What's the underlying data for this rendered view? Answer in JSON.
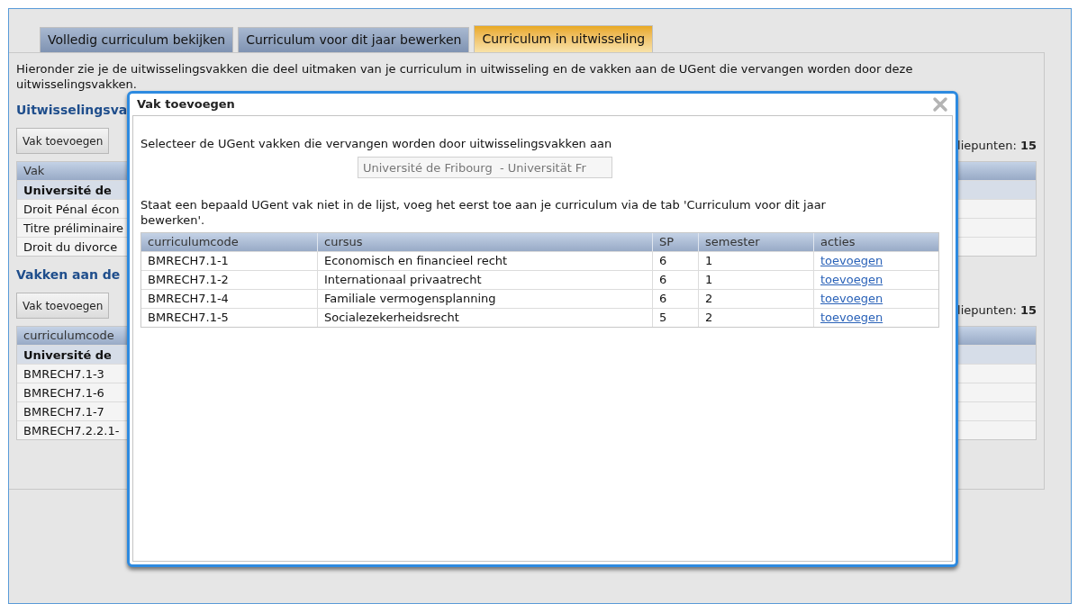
{
  "tabs": [
    {
      "label": "Volledig curriculum bekijken",
      "selected": false
    },
    {
      "label": "Curriculum voor dit jaar bewerken",
      "selected": false
    },
    {
      "label": "Curriculum in uitwisseling",
      "selected": true
    }
  ],
  "intro": [
    "Hieronder zie je de uitwisselingsvakken die deel uitmaken van je curriculum in uitwisseling en de vakken aan de UGent die vervangen worden door deze",
    "uitwisselingsvakken."
  ],
  "sections": [
    {
      "heading": "Uitwisselingsva",
      "button": "Vak toevoegen",
      "credits": "liepunten: **15**",
      "column": "Vak",
      "rows": [
        {
          "text": "Université de ",
          "kind": "group"
        },
        {
          "text": "Droit Pénal écon",
          "kind": "course"
        },
        {
          "text": "Titre préliminaire",
          "kind": "course"
        },
        {
          "text": "Droit du divorce",
          "kind": "course"
        }
      ]
    },
    {
      "heading": "Vakken aan de",
      "button": "Vak toevoegen",
      "credits": "liepunten: **15**",
      "column": "curriculumcode",
      "rows": [
        {
          "text": "Université de ",
          "kind": "group"
        },
        {
          "text": "BMRECH7.1-3",
          "kind": "course"
        },
        {
          "text": "BMRECH7.1-6",
          "kind": "course"
        },
        {
          "text": "BMRECH7.1-7",
          "kind": "course"
        },
        {
          "text": "BMRECH7.2.2.1-",
          "kind": "course"
        }
      ]
    }
  ],
  "dialog": {
    "title": "Vak toevoegen",
    "prompt": "Selecteer de UGent vakken die vervangen worden door uitwisselingsvakken aan",
    "university_field": {
      "value": "Université de Fribourg  - Universität Fr"
    },
    "note": "Staat een bepaald UGent vak niet in de lijst, voeg het eerst toe aan je curriculum via de tab 'Curriculum voor dit jaar bewerken'.",
    "table": {
      "columns": [
        "curriculumcode",
        "cursus",
        "SP",
        "semester",
        "acties"
      ],
      "rows": [
        {
          "code": "BMRECH7.1-1",
          "course": "Economisch en financieel recht",
          "sp": "6",
          "semester": "1",
          "action": "toevoegen"
        },
        {
          "code": "BMRECH7.1-2",
          "course": "Internationaal privaatrecht",
          "sp": "6",
          "semester": "1",
          "action": "toevoegen"
        },
        {
          "code": "BMRECH7.1-4",
          "course": "Familiale vermogensplanning",
          "sp": "6",
          "semester": "2",
          "action": "toevoegen"
        },
        {
          "code": "BMRECH7.1-5",
          "course": "Socialezekerheidsrecht",
          "sp": "5",
          "semester": "2",
          "action": "toevoegen"
        }
      ]
    }
  }
}
